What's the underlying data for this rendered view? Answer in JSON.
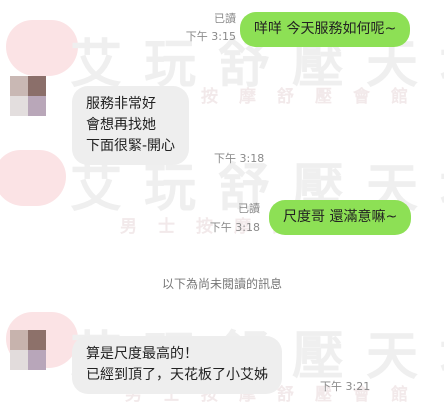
{
  "watermark": {
    "title": "艾玩舒壓天地",
    "subtitle": "男士按摩舒壓會館"
  },
  "messages": [
    {
      "direction": "out",
      "lines": [
        "咩咩 今天服務如何呢~"
      ],
      "read": "已讀",
      "time": "下午 3:15"
    },
    {
      "direction": "in",
      "lines": [
        "服務非常好",
        "會想再找她",
        "下面很緊-開心"
      ],
      "time": "下午 3:18"
    },
    {
      "direction": "out",
      "lines": [
        "尺度哥 還滿意嘛~"
      ],
      "read": "已讀",
      "time": "下午 3:18"
    },
    {
      "direction": "in",
      "lines": [
        "算是尺度最高的！",
        "已經到頂了，天花板了小艾姊"
      ],
      "time": "下午 3:21"
    }
  ],
  "divider": "以下為尚未閱讀的訊息",
  "colors": {
    "outgoing": "#8de055",
    "incoming": "#eeeeee"
  },
  "avatar": "blurred-user-avatar"
}
